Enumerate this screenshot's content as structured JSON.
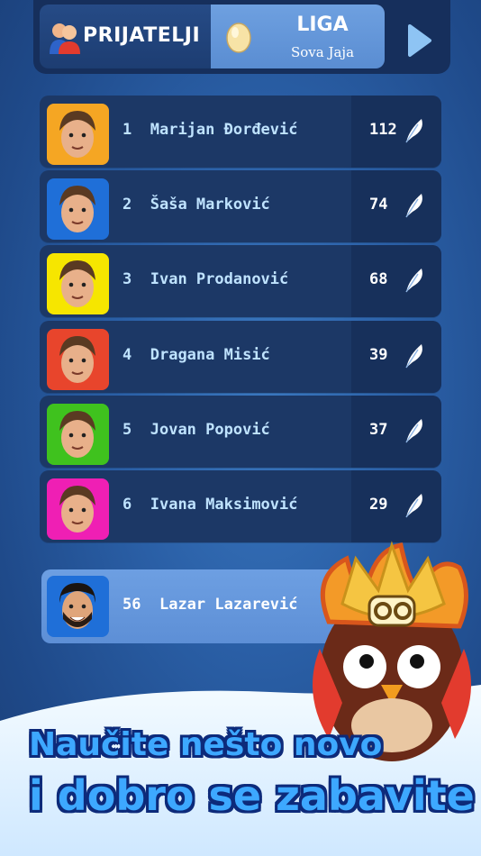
{
  "header": {
    "friends_tab": "PRIJATELJI",
    "league_tab_title": "LIGA",
    "league_tab_subtitle": "Sova Jaja"
  },
  "leaderboard": [
    {
      "rank": "1",
      "name": "Marijan Đorđević",
      "score": "112",
      "avatar_color": "#f5a623"
    },
    {
      "rank": "2",
      "name": "Šaša Marković",
      "score": "74",
      "avatar_color": "#1f6fd8"
    },
    {
      "rank": "3",
      "name": "Ivan Prodanović",
      "score": "68",
      "avatar_color": "#f6e600"
    },
    {
      "rank": "4",
      "name": "Dragana Misić",
      "score": "39",
      "avatar_color": "#e8452c"
    },
    {
      "rank": "5",
      "name": "Jovan Popović",
      "score": "37",
      "avatar_color": "#3fc21e"
    },
    {
      "rank": "6",
      "name": "Ivana Maksimović",
      "score": "29",
      "avatar_color": "#ef1fb4"
    }
  ],
  "current_user": {
    "rank": "56",
    "name": "Lazar Lazarević",
    "avatar_color": "#1f6fd8"
  },
  "slogan": {
    "line1": "Naučite nešto novo",
    "line2": "i dobro se zabavite"
  },
  "colors": {
    "background": "#2a5fa6",
    "row": "#1c3866",
    "active_tab": "#6ea0e0",
    "slogan_text": "#3da8ff"
  }
}
